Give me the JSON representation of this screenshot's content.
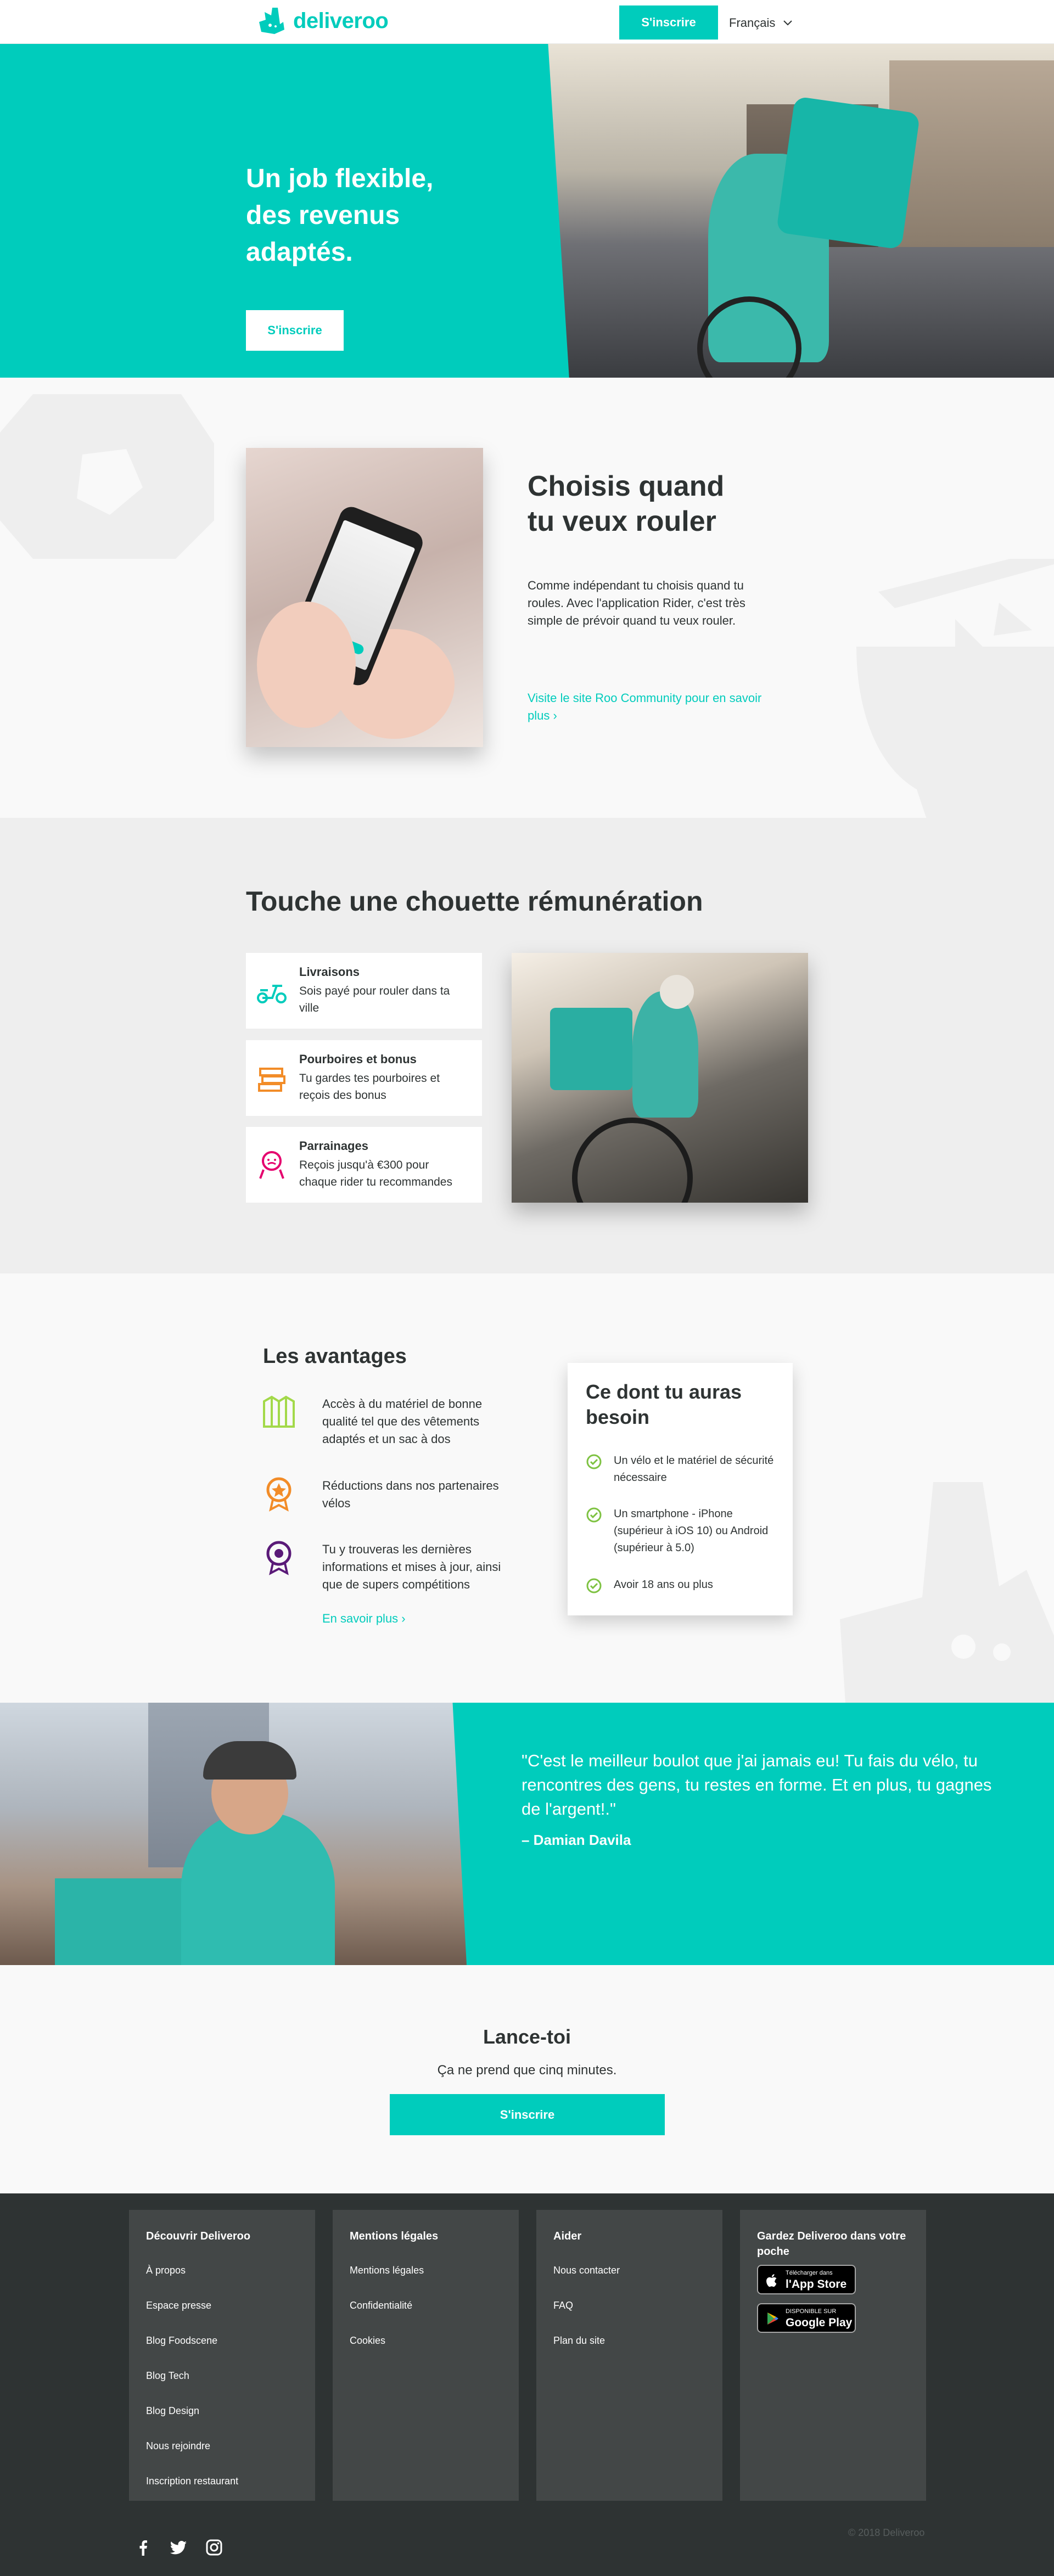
{
  "brand": {
    "name": "deliveroo",
    "accent": "#00ccbc",
    "dark": "#2e3333"
  },
  "header": {
    "signup_label": "S'inscrire",
    "language": "Français"
  },
  "hero": {
    "title": "Un job flexible, des revenus adaptés.",
    "cta_label": "S'inscrire"
  },
  "choose": {
    "title": "Choisis quand tu veux rouler",
    "text": "Comme indépendant tu choisis quand tu roules. Avec l'application Rider, c'est très simple de prévoir quand tu veux rouler.",
    "link": "Visite le site Roo Community pour en savoir plus ›"
  },
  "pay": {
    "title": "Touche une chouette rémunération",
    "cards": [
      {
        "icon": "scooter-icon",
        "label": "Livraisons",
        "desc": "Sois payé pour rouler dans ta ville",
        "color": "#00ccbc"
      },
      {
        "icon": "cash-icon",
        "label": "Pourboires et bonus",
        "desc": "Tu gardes tes pourboires et reçois des bonus",
        "color": "#f28c28"
      },
      {
        "icon": "referral-icon",
        "label": "Parrainages",
        "desc": "Reçois jusqu'à €300 pour chaque rider tu recommandes",
        "color": "#e5006e"
      }
    ]
  },
  "advantages": {
    "title": "Les avantages",
    "items": [
      {
        "icon": "equipment-icon",
        "text": "Accès à du matériel de bonne qualité tel que des vêtements adaptés et un sac à dos",
        "color": "#a3d94a"
      },
      {
        "icon": "medal-icon",
        "text": "Réductions dans nos partenaires vélos",
        "color": "#f28c28"
      },
      {
        "icon": "badge-icon",
        "text": "Tu y trouveras les dernières informations et mises à jour, ainsi que de supers compétitions",
        "color": "#5a1a78"
      }
    ],
    "link": "En savoir plus ›"
  },
  "needs": {
    "title": "Ce dont tu auras besoin",
    "items": [
      "Un vélo et le matériel de sécurité nécessaire",
      "Un smartphone - iPhone (supérieur à iOS 10) ou Android (supérieur à 5.0)",
      "Avoir 18 ans ou plus"
    ],
    "check_color": "#7ec242"
  },
  "testimonial": {
    "quote": "\"C'est le meilleur boulot que j'ai jamais eu! Tu fais du vélo, tu rencontres des gens, tu restes en forme. Et en plus, tu gagnes de l'argent!.\"",
    "author": "– Damian Davila"
  },
  "cta": {
    "title": "Lance-toi",
    "subtitle": "Ça ne prend que cinq minutes.",
    "button": "S'inscrire"
  },
  "footer": {
    "columns": [
      {
        "title": "Découvrir Deliveroo",
        "links": [
          "À propos",
          "Espace presse",
          "Blog Foodscene",
          "Blog Tech",
          "Blog Design",
          "Nous rejoindre",
          "Inscription restaurant"
        ]
      },
      {
        "title": "Mentions légales",
        "links": [
          "Mentions légales",
          "Confidentialité",
          "Cookies"
        ]
      },
      {
        "title": "Aider",
        "links": [
          "Nous contacter",
          "FAQ",
          "Plan du site"
        ]
      }
    ],
    "apps": {
      "title": "Gardez Deliveroo dans votre poche",
      "app_store_small": "Télécharger dans",
      "app_store_big": "l'App Store",
      "google_play_small": "DISPONIBLE SUR",
      "google_play_big": "Google Play"
    },
    "social": [
      "facebook-icon",
      "twitter-icon",
      "instagram-icon"
    ],
    "copyright": "© 2018 Deliveroo"
  }
}
